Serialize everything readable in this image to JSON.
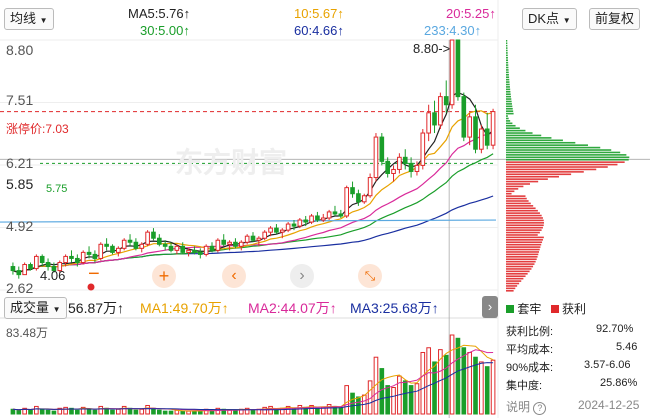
{
  "toolbar": {
    "indicator_select": "均线",
    "dk_select": "DK点",
    "adjust_button": "前复权"
  },
  "ma_row": {
    "ma5": "MA5:5.76",
    "ma10": "10:5.67",
    "ma20": "20:5.25",
    "ma30": "30:5.00",
    "ma60": "60:4.66",
    "ma233": "233:4.30",
    "arrow": "↑"
  },
  "price_axis": {
    "labels": [
      "8.80",
      "7.51",
      "6.21",
      "4.92",
      "2.62"
    ],
    "current_price": "5.85",
    "limit_up_label": "涨停价:7.03",
    "cost_line_label": "5.75",
    "high_marker": "8.80->",
    "low_marker": "4.06"
  },
  "volume_row": {
    "select": "成交量",
    "value": "56.87万",
    "ma1": "MA1:49.70万",
    "ma2": "MA2:44.07万",
    "ma3": "MA3:25.68万",
    "arrow": "↑",
    "max_label": "83.48万"
  },
  "watermark": "东方财富",
  "right_panel": {
    "legend_locked": "套牢",
    "legend_profit": "获利",
    "stats": [
      {
        "label": "获利比例:",
        "value": "92.70%"
      },
      {
        "label": "平均成本:",
        "value": "5.46"
      },
      {
        "label": "90%成本:",
        "value": "3.57-6.06"
      },
      {
        "label": "集中度:",
        "value": "25.86%"
      }
    ],
    "note_label": "说明",
    "date": "2024-12-25"
  },
  "colors": {
    "up": "#e0292b",
    "down": "#1a9e2a",
    "ma5": "#222222",
    "ma10": "#e8a200",
    "ma20": "#d92a9a",
    "ma30": "#1a9e2a",
    "ma60": "#1a2fa0",
    "ma233": "#5aa8e0",
    "limit_up": "#e0292b"
  },
  "chart_data": {
    "type": "candlestick",
    "y_range": [
      2.62,
      8.8
    ],
    "candles": [
      [
        3.2,
        3.3,
        3.0,
        3.1
      ],
      [
        3.1,
        3.2,
        2.9,
        3.0
      ],
      [
        3.0,
        3.3,
        3.0,
        3.25
      ],
      [
        3.25,
        3.3,
        3.1,
        3.15
      ],
      [
        3.15,
        3.5,
        3.1,
        3.45
      ],
      [
        3.45,
        3.5,
        3.2,
        3.3
      ],
      [
        3.3,
        3.4,
        3.1,
        3.2
      ],
      [
        3.2,
        3.3,
        3.05,
        3.1
      ],
      [
        3.1,
        3.35,
        3.05,
        3.3
      ],
      [
        3.3,
        3.5,
        3.2,
        3.45
      ],
      [
        3.45,
        3.6,
        3.3,
        3.4
      ],
      [
        3.4,
        3.5,
        3.2,
        3.3
      ],
      [
        3.3,
        3.6,
        3.25,
        3.55
      ],
      [
        3.55,
        3.7,
        3.4,
        3.5
      ],
      [
        3.5,
        3.6,
        3.3,
        3.4
      ],
      [
        3.4,
        3.8,
        3.35,
        3.75
      ],
      [
        3.75,
        3.9,
        3.6,
        3.7
      ],
      [
        3.7,
        3.75,
        3.5,
        3.55
      ],
      [
        3.55,
        3.7,
        3.45,
        3.65
      ],
      [
        3.65,
        3.9,
        3.6,
        3.85
      ],
      [
        3.85,
        4.0,
        3.7,
        3.8
      ],
      [
        3.8,
        3.9,
        3.6,
        3.65
      ],
      [
        3.65,
        3.8,
        3.55,
        3.75
      ],
      [
        3.75,
        4.1,
        3.7,
        4.05
      ],
      [
        4.05,
        4.15,
        3.85,
        3.9
      ],
      [
        3.9,
        4.0,
        3.7,
        3.75
      ],
      [
        3.75,
        3.85,
        3.6,
        3.7
      ],
      [
        3.7,
        3.8,
        3.55,
        3.6
      ],
      [
        3.6,
        3.75,
        3.5,
        3.7
      ],
      [
        3.7,
        3.8,
        3.5,
        3.55
      ],
      [
        3.55,
        3.65,
        3.45,
        3.6
      ],
      [
        3.6,
        3.7,
        3.5,
        3.55
      ],
      [
        3.55,
        3.65,
        3.4,
        3.5
      ],
      [
        3.5,
        3.75,
        3.45,
        3.7
      ],
      [
        3.7,
        3.8,
        3.55,
        3.6
      ],
      [
        3.6,
        3.9,
        3.55,
        3.85
      ],
      [
        3.85,
        4.0,
        3.7,
        3.75
      ],
      [
        3.75,
        3.85,
        3.6,
        3.8
      ],
      [
        3.8,
        3.9,
        3.65,
        3.7
      ],
      [
        3.7,
        3.85,
        3.6,
        3.8
      ],
      [
        3.8,
        4.0,
        3.75,
        3.95
      ],
      [
        3.95,
        4.05,
        3.8,
        3.85
      ],
      [
        3.85,
        3.95,
        3.7,
        3.9
      ],
      [
        3.9,
        4.1,
        3.85,
        4.05
      ],
      [
        4.05,
        4.2,
        3.95,
        4.15
      ],
      [
        4.15,
        4.25,
        4.0,
        4.05
      ],
      [
        4.05,
        4.15,
        3.9,
        4.1
      ],
      [
        4.1,
        4.3,
        4.05,
        4.25
      ],
      [
        4.25,
        4.35,
        4.1,
        4.2
      ],
      [
        4.2,
        4.4,
        4.15,
        4.35
      ],
      [
        4.35,
        4.45,
        4.2,
        4.3
      ],
      [
        4.3,
        4.5,
        4.25,
        4.45
      ],
      [
        4.45,
        4.55,
        4.3,
        4.35
      ],
      [
        4.35,
        4.5,
        4.3,
        4.4
      ],
      [
        4.4,
        4.6,
        4.35,
        4.55
      ],
      [
        4.55,
        4.7,
        4.45,
        4.5
      ],
      [
        4.5,
        4.6,
        4.4,
        4.45
      ],
      [
        4.45,
        5.2,
        4.4,
        5.15
      ],
      [
        5.15,
        5.3,
        4.9,
        5.0
      ],
      [
        5.0,
        5.1,
        4.7,
        4.8
      ],
      [
        4.8,
        5.0,
        4.75,
        4.95
      ],
      [
        4.95,
        5.5,
        4.9,
        5.4
      ],
      [
        5.4,
        6.5,
        5.3,
        6.4
      ],
      [
        6.4,
        6.5,
        5.7,
        5.8
      ],
      [
        5.8,
        5.9,
        5.4,
        5.5
      ],
      [
        5.5,
        5.7,
        5.3,
        5.6
      ],
      [
        5.6,
        6.0,
        5.5,
        5.9
      ],
      [
        5.9,
        6.1,
        5.6,
        5.75
      ],
      [
        5.75,
        5.9,
        5.4,
        5.55
      ],
      [
        5.55,
        5.8,
        5.45,
        5.7
      ],
      [
        5.7,
        6.6,
        5.6,
        6.5
      ],
      [
        6.5,
        7.2,
        6.3,
        7.0
      ],
      [
        7.0,
        7.3,
        6.5,
        6.7
      ],
      [
        6.7,
        7.5,
        6.6,
        7.4
      ],
      [
        7.4,
        7.8,
        7.0,
        7.2
      ],
      [
        7.2,
        8.8,
        7.1,
        8.8
      ],
      [
        8.8,
        8.8,
        7.3,
        7.4
      ],
      [
        7.4,
        7.5,
        6.3,
        6.4
      ],
      [
        6.4,
        7.0,
        6.2,
        6.9
      ],
      [
        6.9,
        7.2,
        6.0,
        6.1
      ],
      [
        6.1,
        6.7,
        6.0,
        6.6
      ],
      [
        6.6,
        7.0,
        6.1,
        6.2
      ],
      [
        6.2,
        7.1,
        6.1,
        7.03
      ]
    ],
    "volume_max": 83.48,
    "volumes": [
      5,
      4,
      6,
      4,
      8,
      5,
      4,
      3,
      6,
      7,
      6,
      4,
      7,
      5,
      4,
      8,
      6,
      4,
      5,
      8,
      6,
      4,
      5,
      9,
      6,
      4,
      3,
      3,
      4,
      3,
      3,
      3,
      3,
      5,
      4,
      6,
      5,
      4,
      4,
      5,
      6,
      4,
      5,
      7,
      8,
      5,
      6,
      8,
      6,
      9,
      7,
      9,
      6,
      7,
      10,
      8,
      7,
      30,
      22,
      18,
      20,
      35,
      60,
      48,
      30,
      28,
      40,
      35,
      30,
      32,
      65,
      70,
      55,
      68,
      62,
      83.48,
      80,
      70,
      65,
      60,
      55,
      50,
      56.87
    ],
    "ma_lines": {
      "ma5": "#222222",
      "ma10": "#e8a200",
      "ma20": "#d92a9a",
      "ma30": "#1a9e2a",
      "ma60": "#1a2fa0",
      "ma233": "#5aa8e0"
    },
    "ma233_value": 4.3,
    "chip_distribution_max_price": 8.8,
    "chip_distribution_min_price": 2.62
  }
}
